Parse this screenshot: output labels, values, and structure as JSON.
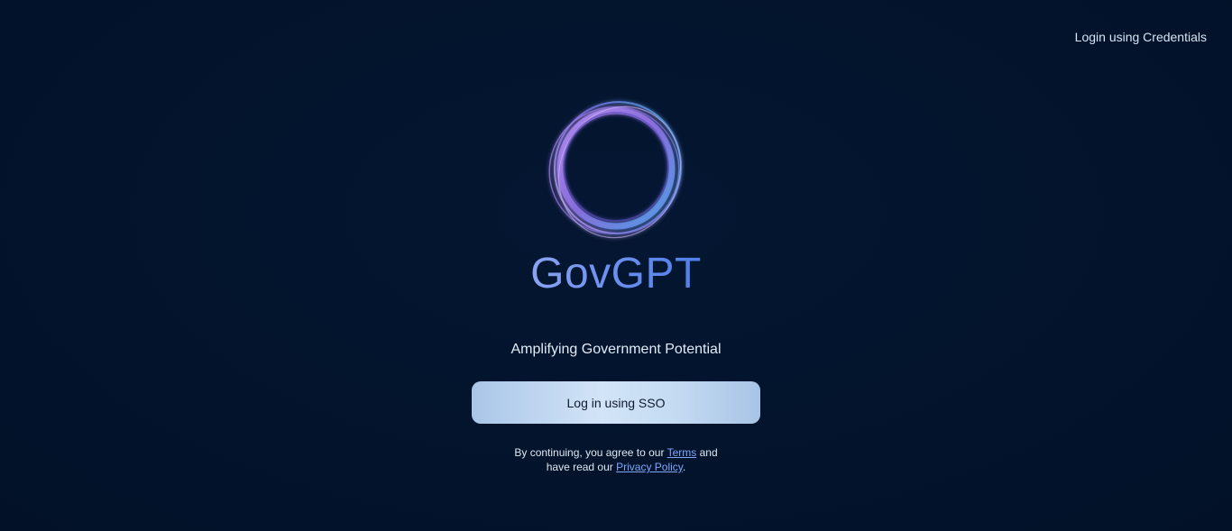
{
  "header": {
    "credentials_link": "Login using Credentials"
  },
  "brand": {
    "name": "GovGPT",
    "logo_icon": "swirl-ring-icon"
  },
  "tagline": "Amplifying Government Potential",
  "sso_button": {
    "label": "Log in using SSO"
  },
  "legal": {
    "prefix": "By continuing, you agree to our",
    "terms_link": "Terms",
    "middle": "and",
    "line2_prefix": "have read our",
    "privacy_link": "Privacy Policy",
    "suffix": "."
  },
  "colors": {
    "background": "#03142d",
    "brand_gradient_start": "#8aa4f2",
    "brand_gradient_end": "#4f7fe8",
    "button_light": "#d2e4f7",
    "link": "#7fa7ff"
  }
}
